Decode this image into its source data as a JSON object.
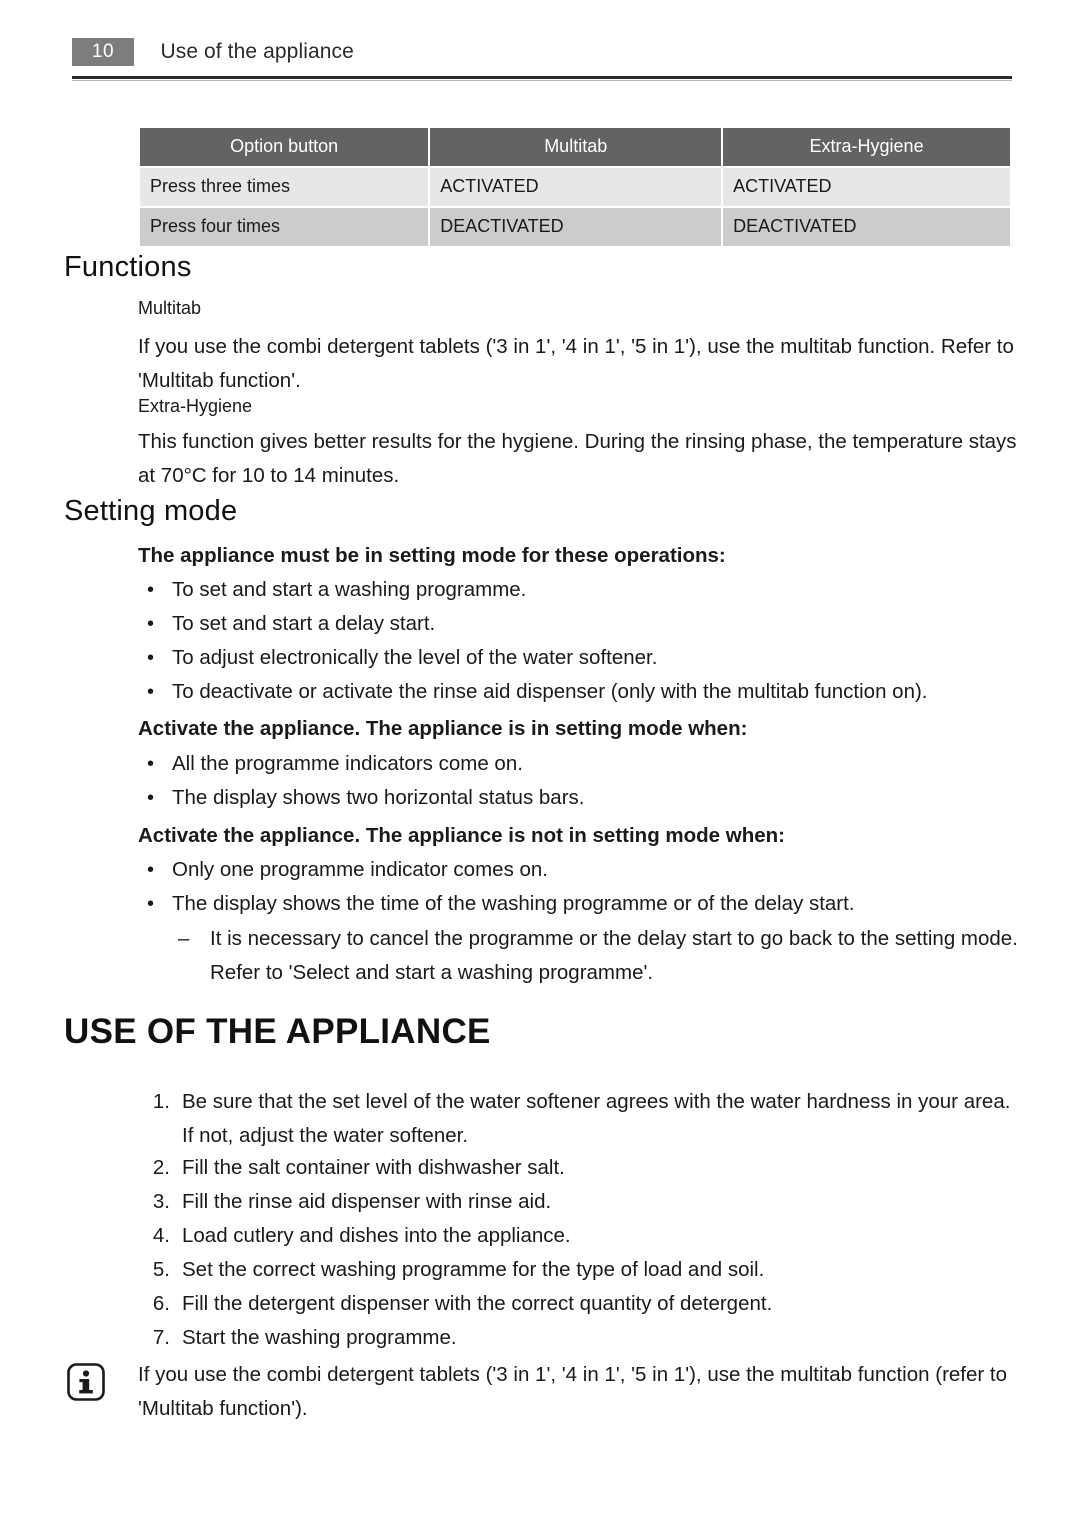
{
  "header": {
    "page_number": "10",
    "title": "Use of the appliance"
  },
  "option_table": {
    "headers": [
      "Option button",
      "Multitab",
      "Extra-Hygiene"
    ],
    "rows": [
      [
        "Press three times",
        "ACTIVATED",
        "ACTIVATED"
      ],
      [
        "Press four times",
        "DEACTIVATED",
        "DEACTIVATED"
      ]
    ]
  },
  "functions": {
    "heading": "Functions",
    "multitab_label": "Multitab",
    "multitab_text": "If you use the combi detergent tablets ('3 in 1', '4 in 1', '5 in 1'), use the multitab function. Refer to 'Multitab function'.",
    "extra_hygiene_label": "Extra-Hygiene",
    "extra_hygiene_text": "This function gives better results for the hygiene. During the rinsing phase, the temperature stays at 70°C for 10 to 14 minutes."
  },
  "setting_mode": {
    "heading": "Setting mode",
    "intro": "The appliance must be in setting mode for these operations:",
    "operations": [
      "To set and start a washing programme.",
      "To set and start a delay start.",
      "To adjust electronically the level of the water softener.",
      "To deactivate or activate the rinse aid dispenser (only with the multitab function on)."
    ],
    "in_mode_heading": "Activate the appliance. The appliance is in setting mode when:",
    "in_mode_items": [
      "All the programme indicators come on.",
      "The display shows two horizontal status bars."
    ],
    "not_in_mode_heading": "Activate the appliance. The appliance is not in setting mode when:",
    "not_in_mode_items": [
      "Only one programme indicator comes on.",
      "The display shows the time of the washing programme or of the delay start."
    ],
    "sub_note": "It is necessary to cancel the programme or the delay start to go back to the setting mode. Refer to 'Select and start a washing programme'.",
    "dash": "–"
  },
  "use_of_appliance": {
    "heading": "USE OF THE APPLIANCE",
    "steps": [
      {
        "num": "1.",
        "text": "Be sure that the set level of the water softener agrees with the water hardness in your area. If not, adjust the water softener."
      },
      {
        "num": "2.",
        "text": "Fill the salt container with dishwasher salt."
      },
      {
        "num": "3.",
        "text": "Fill the rinse aid dispenser with rinse aid."
      },
      {
        "num": "4.",
        "text": "Load cutlery and dishes into the appliance."
      },
      {
        "num": "5.",
        "text": "Set the correct washing programme for the type of load and soil."
      },
      {
        "num": "6.",
        "text": "Fill the detergent dispenser with the correct quantity of detergent."
      },
      {
        "num": "7.",
        "text": "Start the washing programme."
      }
    ]
  },
  "note": {
    "icon": "info-icon",
    "icon_glyph": "i",
    "text": "If you use the combi detergent tablets ('3 in 1', '4 in 1', '5 in 1'), use the multitab function (refer to 'Multitab function')."
  },
  "bullet_glyph": "•",
  "colors": {
    "table_header_bg": "#636363",
    "row_light": "#e7e7e7",
    "row_dark": "#cccccc",
    "page_number_bg": "#7d7d7d",
    "rule": "#2b2b2b"
  }
}
